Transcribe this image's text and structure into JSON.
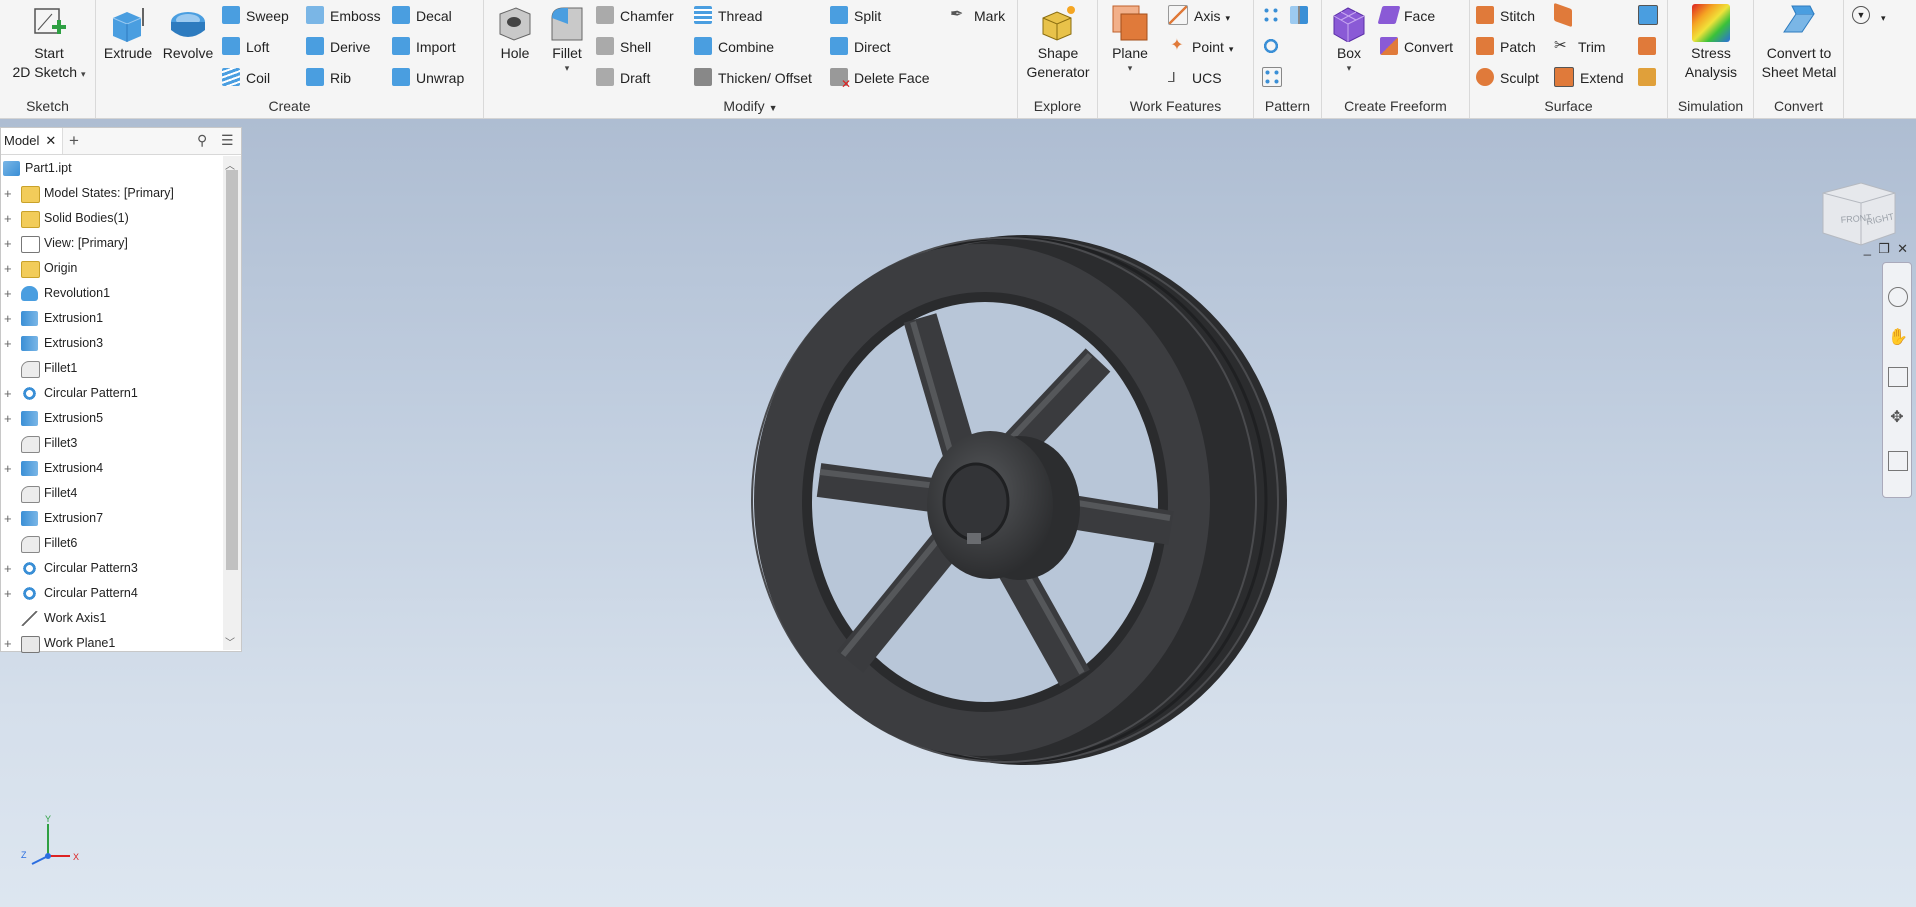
{
  "ribbon": {
    "sketch": {
      "title": "Sketch",
      "start_line1": "Start",
      "start_line2": "2D Sketch"
    },
    "create": {
      "title": "Create",
      "extrude": "Extrude",
      "revolve": "Revolve",
      "sweep": "Sweep",
      "loft": "Loft",
      "coil": "Coil",
      "emboss": "Emboss",
      "derive": "Derive",
      "rib": "Rib",
      "decal": "Decal",
      "import": "Import",
      "unwrap": "Unwrap"
    },
    "modify": {
      "title": "Modify",
      "hole": "Hole",
      "fillet": "Fillet",
      "chamfer": "Chamfer",
      "shell": "Shell",
      "draft": "Draft",
      "thread": "Thread",
      "combine": "Combine",
      "thicken": "Thicken/ Offset",
      "split": "Split",
      "direct": "Direct",
      "delete_face": "Delete Face",
      "mark": "Mark"
    },
    "explore": {
      "title": "Explore",
      "shape_line1": "Shape",
      "shape_line2": "Generator"
    },
    "work_features": {
      "title": "Work Features",
      "plane": "Plane",
      "axis": "Axis",
      "point": "Point",
      "ucs": "UCS"
    },
    "pattern": {
      "title": "Pattern"
    },
    "freeform": {
      "title": "Create Freeform",
      "box": "Box",
      "face": "Face",
      "convert": "Convert"
    },
    "surface": {
      "title": "Surface",
      "stitch": "Stitch",
      "patch": "Patch",
      "sculpt": "Sculpt",
      "trim": "Trim",
      "extend": "Extend"
    },
    "simulation": {
      "title": "Simulation",
      "stress_line1": "Stress",
      "stress_line2": "Analysis"
    },
    "convert": {
      "title": "Convert",
      "sheet_line1": "Convert to",
      "sheet_line2": "Sheet Metal"
    }
  },
  "browser": {
    "tab_label": "Model",
    "items": [
      {
        "label": "Part1.ipt",
        "icon": "part-icon"
      },
      {
        "label": "Model States: [Primary]",
        "icon": "folder-icon"
      },
      {
        "label": "Solid Bodies(1)",
        "icon": "folder-icon"
      },
      {
        "label": "View: [Primary]",
        "icon": "view-icon"
      },
      {
        "label": "Origin",
        "icon": "folder-icon"
      },
      {
        "label": "Revolution1",
        "icon": "revolve-icon"
      },
      {
        "label": "Extrusion1",
        "icon": "extrude-icon"
      },
      {
        "label": "Extrusion3",
        "icon": "extrude-icon"
      },
      {
        "label": "Fillet1",
        "icon": "fillet-icon"
      },
      {
        "label": "Circular Pattern1",
        "icon": "pattern-icon"
      },
      {
        "label": "Extrusion5",
        "icon": "extrude-icon"
      },
      {
        "label": "Fillet3",
        "icon": "fillet-icon"
      },
      {
        "label": "Extrusion4",
        "icon": "extrude-icon"
      },
      {
        "label": "Fillet4",
        "icon": "fillet-icon"
      },
      {
        "label": "Extrusion7",
        "icon": "extrude-icon"
      },
      {
        "label": "Fillet6",
        "icon": "fillet-icon"
      },
      {
        "label": "Circular Pattern3",
        "icon": "pattern-icon"
      },
      {
        "label": "Circular Pattern4",
        "icon": "pattern-icon"
      },
      {
        "label": "Work Axis1",
        "icon": "work-axis-icon"
      },
      {
        "label": "Work Plane1",
        "icon": "work-plane-icon"
      }
    ]
  },
  "viewcube": {
    "front": "FRONT",
    "right": "RIGHT"
  },
  "triad": {
    "x": "X",
    "y": "Y",
    "z": "Z"
  },
  "colors": {
    "accent_blue": "#3a8fd6",
    "orange": "#e07a3a",
    "wheel": "#3a3b3d",
    "viewport_top": "#aebdd2",
    "viewport_bottom": "#dde6f0"
  }
}
